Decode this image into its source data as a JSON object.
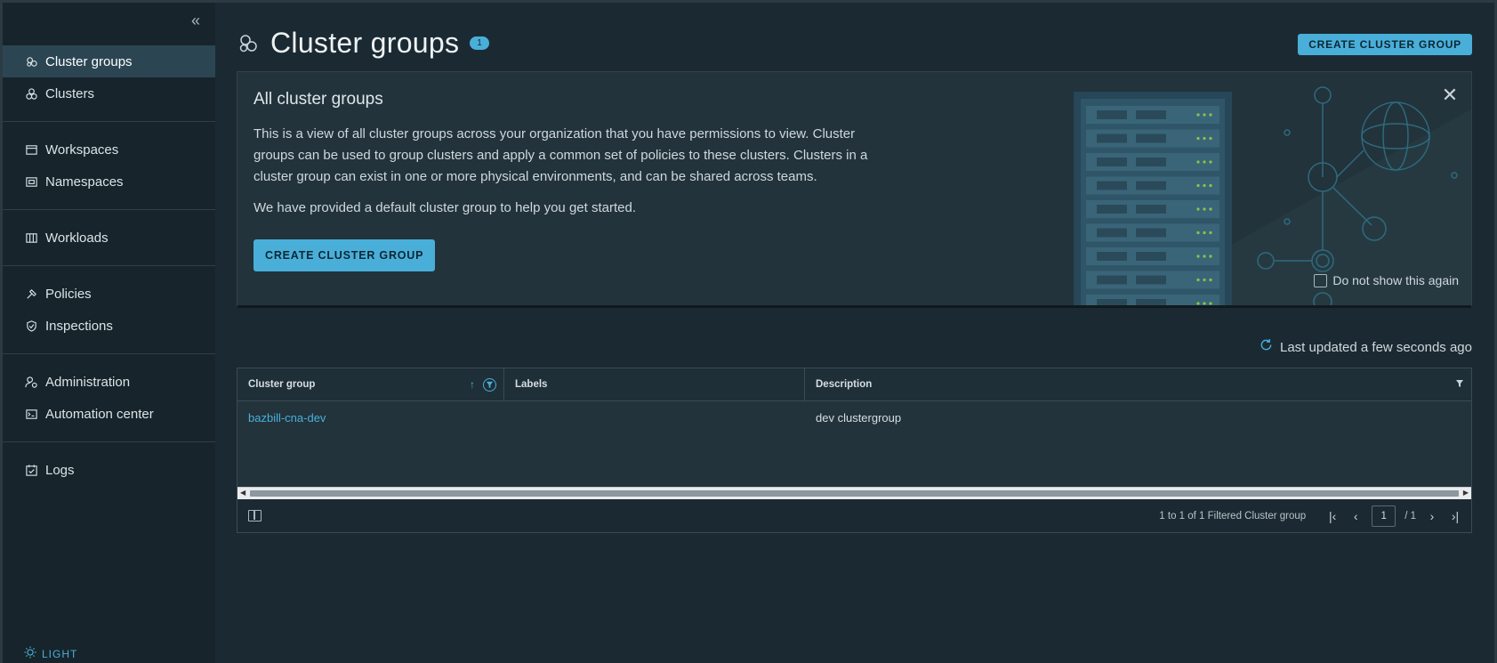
{
  "sidebar": {
    "collapse_icon": "double-chevron-left-icon",
    "items": [
      {
        "label": "Cluster groups",
        "icon": "cluster-groups-icon",
        "active": true
      },
      {
        "label": "Clusters",
        "icon": "clusters-icon"
      },
      {
        "label": "Workspaces",
        "icon": "workspaces-icon"
      },
      {
        "label": "Namespaces",
        "icon": "namespaces-icon"
      },
      {
        "label": "Workloads",
        "icon": "workloads-icon"
      },
      {
        "label": "Policies",
        "icon": "policies-icon"
      },
      {
        "label": "Inspections",
        "icon": "inspections-icon"
      },
      {
        "label": "Administration",
        "icon": "administration-icon"
      },
      {
        "label": "Automation center",
        "icon": "automation-icon"
      },
      {
        "label": "Logs",
        "icon": "logs-icon"
      }
    ],
    "theme_toggle": "LIGHT"
  },
  "header": {
    "title": "Cluster groups",
    "count": "1",
    "create_button": "CREATE CLUSTER GROUP"
  },
  "banner": {
    "title": "All cluster groups",
    "description": "This is a view of all cluster groups across your organization that you have permissions to view. Cluster groups can be used to group clusters and apply a common set of policies to these clusters. Clusters in a cluster group can exist in one or more physical environments, and can be shared across teams.",
    "description2": "We have provided a default cluster group to help you get started.",
    "create_button": "CREATE CLUSTER GROUP",
    "dont_show": "Do not show this again"
  },
  "status": {
    "last_updated": "Last updated a few seconds ago"
  },
  "grid": {
    "columns": [
      "Cluster group",
      "Labels",
      "Description"
    ],
    "rows": [
      {
        "cluster_group": "bazbill-cna-dev",
        "labels": "",
        "description": "dev clustergroup"
      }
    ],
    "footer": {
      "summary": "1 to 1 of 1 Filtered Cluster group",
      "page": "1",
      "total_pages": "/ 1"
    }
  },
  "colors": {
    "accent": "#49afd9",
    "background": "#1b2a32",
    "sidebar": "#17242b",
    "active_nav": "#2b4553"
  }
}
